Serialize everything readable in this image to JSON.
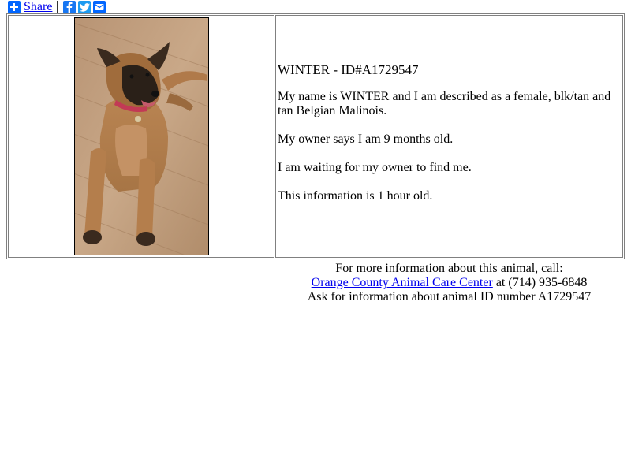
{
  "sharebar": {
    "share_label": "Share",
    "icons": [
      "share-plus-icon",
      "facebook-icon",
      "twitter-icon",
      "email-icon"
    ]
  },
  "animal": {
    "title": "WINTER - ID#A1729547",
    "description": "My name is WINTER and I am described as a female, blk/tan and tan Belgian Malinois.",
    "age": "My owner says I am 9 months old.",
    "status": "I am waiting for my owner to find me.",
    "freshness": "This information is 1 hour old."
  },
  "footer": {
    "line1": "For more information about this animal, call:",
    "center_link": "Orange County Animal Care Center",
    "phone_text": " at (714) 935-6848",
    "line3": "Ask for information about animal ID number A1729547"
  },
  "colors": {
    "link": "#0000ee",
    "share_blue": "#0166ff",
    "facebook": "#1877f2",
    "twitter": "#1d9bf0"
  }
}
